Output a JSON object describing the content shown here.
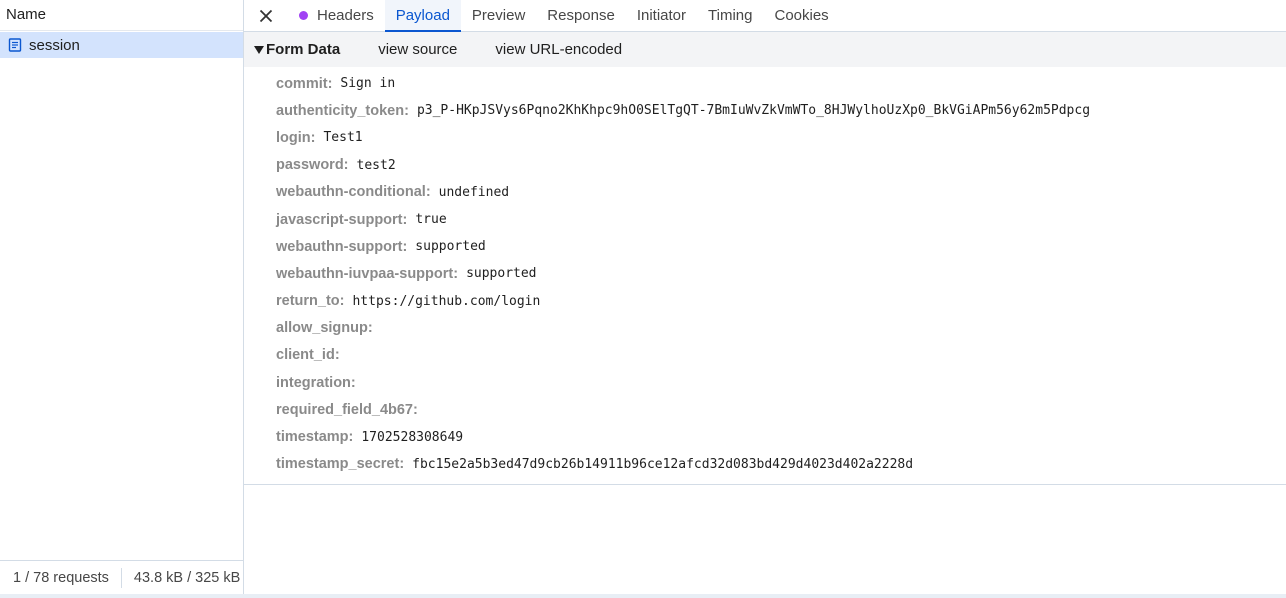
{
  "request_list": {
    "column_header": "Name",
    "items": [
      {
        "name": "session",
        "icon": "document-icon",
        "selected": true
      }
    ],
    "footer": {
      "requests": "1 / 78 requests",
      "transferred": "43.8 kB / 325 kB"
    }
  },
  "tabs": [
    {
      "label": "Headers",
      "has_dot": true
    },
    {
      "label": "Payload",
      "active": true
    },
    {
      "label": "Preview"
    },
    {
      "label": "Response"
    },
    {
      "label": "Initiator"
    },
    {
      "label": "Timing"
    },
    {
      "label": "Cookies"
    }
  ],
  "form_data": {
    "title": "Form Data",
    "view_source": "view source",
    "view_url_encoded": "view URL-encoded",
    "fields": [
      {
        "key": "commit:",
        "value": "Sign in"
      },
      {
        "key": "authenticity_token:",
        "value": "p3_P-HKpJSVys6Pqno2KhKhpc9hO0SElTgQT-7BmIuWvZkVmWTo_8HJWylhoUzXp0_BkVGiAPm56y62m5Pdpcg"
      },
      {
        "key": "login:",
        "value": "Test1"
      },
      {
        "key": "password:",
        "value": "test2"
      },
      {
        "key": "webauthn-conditional:",
        "value": "undefined"
      },
      {
        "key": "javascript-support:",
        "value": "true"
      },
      {
        "key": "webauthn-support:",
        "value": "supported"
      },
      {
        "key": "webauthn-iuvpaa-support:",
        "value": "supported"
      },
      {
        "key": "return_to:",
        "value": "https://github.com/login"
      },
      {
        "key": "allow_signup:",
        "value": ""
      },
      {
        "key": "client_id:",
        "value": ""
      },
      {
        "key": "integration:",
        "value": ""
      },
      {
        "key": "required_field_4b67:",
        "value": ""
      },
      {
        "key": "timestamp:",
        "value": "1702528308649"
      },
      {
        "key": "timestamp_secret:",
        "value": "fbc15e2a5b3ed47d9cb26b14911b96ce12afcd32d083bd429d4023d402a2228d"
      }
    ]
  },
  "colors": {
    "accent": "#0b57d0",
    "selected_row": "#d3e3fd",
    "headers_dot": "#a142f4"
  }
}
